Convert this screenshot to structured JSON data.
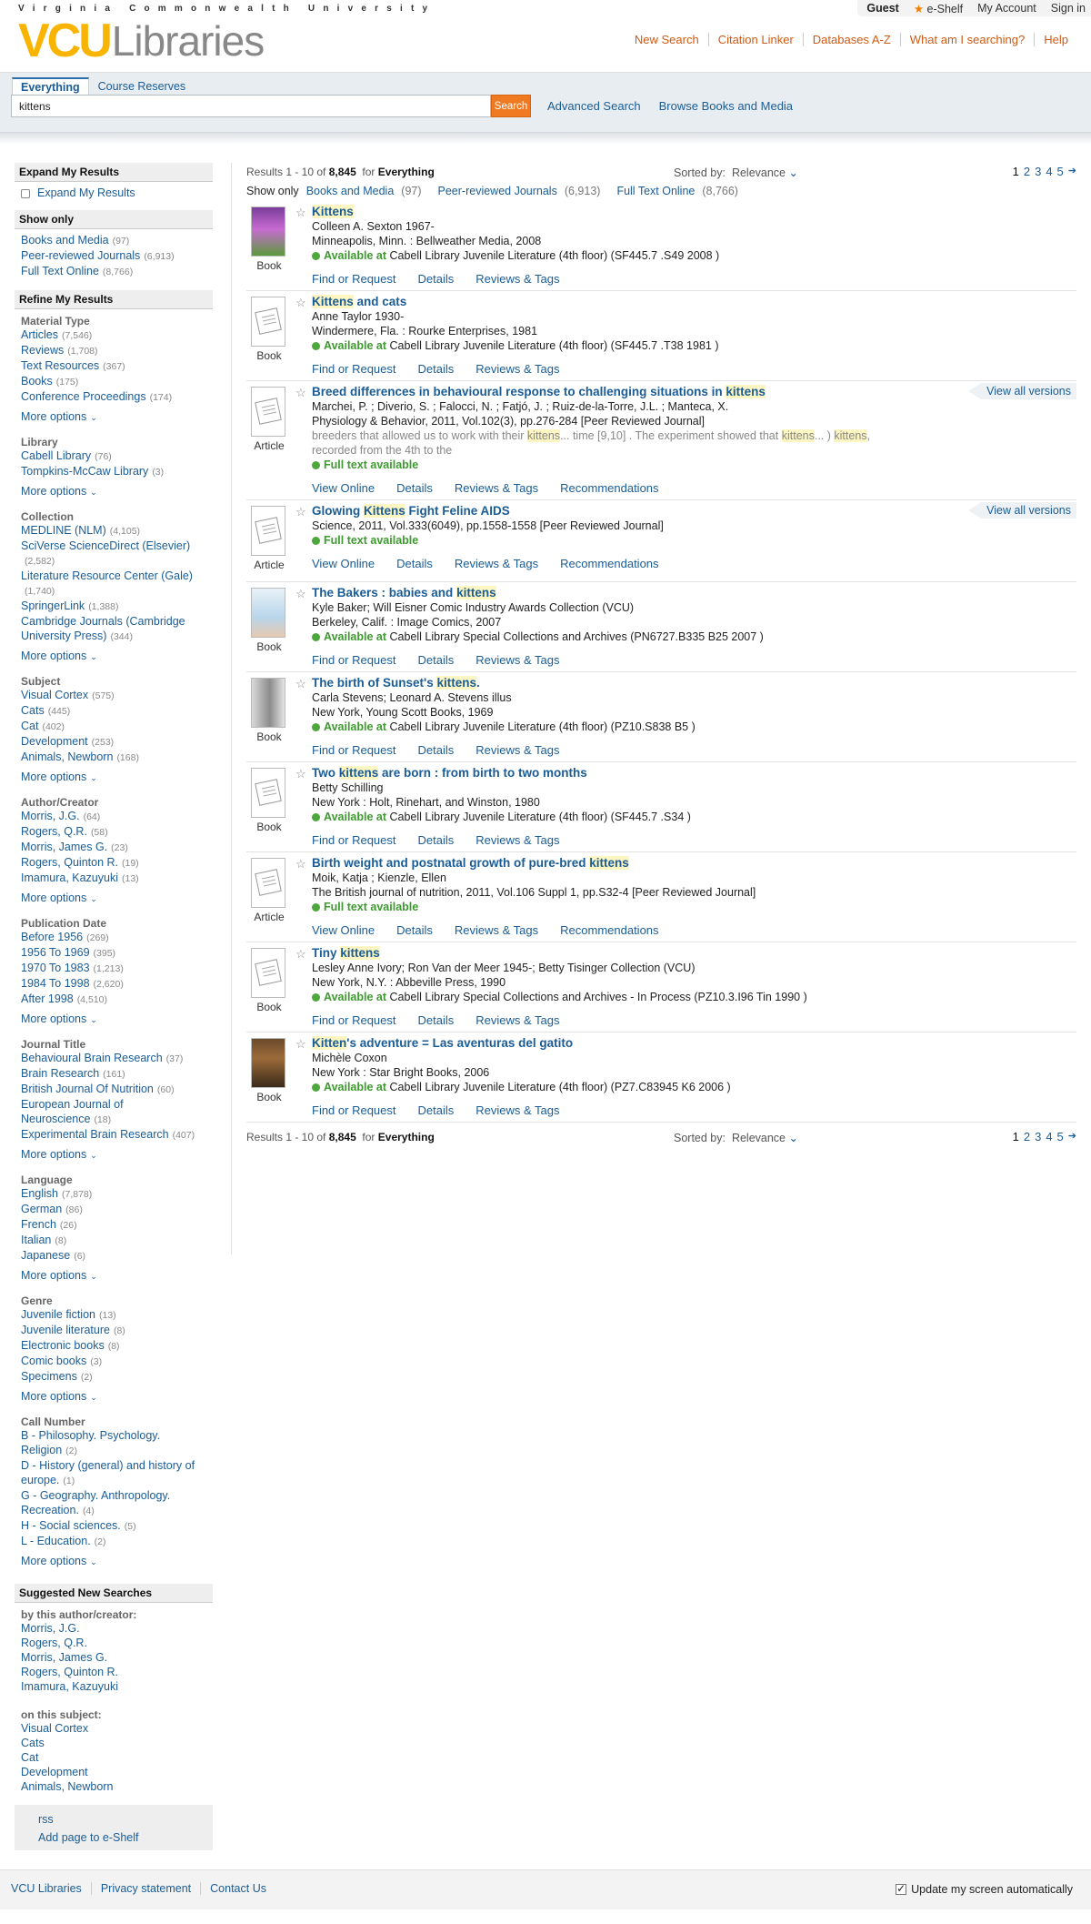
{
  "header": {
    "university": "Virginia Commonwealth University",
    "logo_vcu": "VCU",
    "logo_libraries": "Libraries",
    "user": {
      "guest": "Guest",
      "eshelf": "e-Shelf",
      "account": "My Account",
      "signin": "Sign in"
    },
    "links": [
      "New Search",
      "Citation Linker",
      "Databases A-Z",
      "What am I searching?",
      "Help"
    ]
  },
  "search": {
    "tabs": [
      "Everything",
      "Course Reserves"
    ],
    "query": "kittens",
    "button": "Search",
    "advanced": "Advanced Search",
    "browse": "Browse Books and Media"
  },
  "sidebar": {
    "expand": {
      "title": "Expand My Results",
      "checkbox": "Expand My Results"
    },
    "showonly": {
      "title": "Show only",
      "items": [
        {
          "label": "Books and Media",
          "count": "(97)"
        },
        {
          "label": "Peer-reviewed Journals",
          "count": "(6,913)"
        },
        {
          "label": "Full Text Online",
          "count": "(8,766)"
        }
      ]
    },
    "refine_title": "Refine My Results",
    "more": "More options",
    "facets": [
      {
        "title": "Material Type",
        "items": [
          {
            "label": "Articles",
            "count": "(7,546)"
          },
          {
            "label": "Reviews",
            "count": "(1,708)"
          },
          {
            "label": "Text Resources",
            "count": "(367)"
          },
          {
            "label": "Books",
            "count": "(175)"
          },
          {
            "label": "Conference Proceedings",
            "count": "(174)"
          }
        ]
      },
      {
        "title": "Library",
        "items": [
          {
            "label": "Cabell Library",
            "count": "(76)"
          },
          {
            "label": "Tompkins-McCaw Library",
            "count": "(3)"
          }
        ]
      },
      {
        "title": "Collection",
        "items": [
          {
            "label": "MEDLINE (NLM)",
            "count": "(4,105)"
          },
          {
            "label": "SciVerse ScienceDirect (Elsevier)",
            "count": "(2,582)"
          },
          {
            "label": "Literature Resource Center (Gale)",
            "count": "(1,740)"
          },
          {
            "label": "SpringerLink",
            "count": "(1,388)"
          },
          {
            "label": "Cambridge Journals (Cambridge University Press)",
            "count": "(344)"
          }
        ]
      },
      {
        "title": "Subject",
        "items": [
          {
            "label": "Visual Cortex",
            "count": "(575)"
          },
          {
            "label": "Cats",
            "count": "(445)"
          },
          {
            "label": "Cat",
            "count": "(402)"
          },
          {
            "label": "Development",
            "count": "(253)"
          },
          {
            "label": "Animals, Newborn",
            "count": "(168)"
          }
        ]
      },
      {
        "title": "Author/Creator",
        "items": [
          {
            "label": "Morris, J.G.",
            "count": "(64)"
          },
          {
            "label": "Rogers, Q.R.",
            "count": "(58)"
          },
          {
            "label": "Morris, James G.",
            "count": "(23)"
          },
          {
            "label": "Rogers, Quinton R.",
            "count": "(19)"
          },
          {
            "label": "Imamura, Kazuyuki",
            "count": "(13)"
          }
        ]
      },
      {
        "title": "Publication Date",
        "items": [
          {
            "label": "Before 1956",
            "count": "(269)"
          },
          {
            "label": "1956 To 1969",
            "count": "(395)"
          },
          {
            "label": "1970 To 1983",
            "count": "(1,213)"
          },
          {
            "label": "1984 To 1998",
            "count": "(2,620)"
          },
          {
            "label": "After 1998",
            "count": "(4,510)"
          }
        ]
      },
      {
        "title": "Journal Title",
        "items": [
          {
            "label": "Behavioural Brain Research",
            "count": "(37)"
          },
          {
            "label": "Brain Research",
            "count": "(161)"
          },
          {
            "label": "British Journal Of Nutrition",
            "count": "(60)"
          },
          {
            "label": "European Journal of Neuroscience",
            "count": "(18)"
          },
          {
            "label": "Experimental Brain Research",
            "count": "(407)"
          }
        ]
      },
      {
        "title": "Language",
        "items": [
          {
            "label": "English",
            "count": "(7,878)"
          },
          {
            "label": "German",
            "count": "(86)"
          },
          {
            "label": "French",
            "count": "(26)"
          },
          {
            "label": "Italian",
            "count": "(8)"
          },
          {
            "label": "Japanese",
            "count": "(6)"
          }
        ]
      },
      {
        "title": "Genre",
        "items": [
          {
            "label": "Juvenile fiction",
            "count": "(13)"
          },
          {
            "label": "Juvenile literature",
            "count": "(8)"
          },
          {
            "label": "Electronic books",
            "count": "(8)"
          },
          {
            "label": "Comic books",
            "count": "(3)"
          },
          {
            "label": "Specimens",
            "count": "(2)"
          }
        ]
      },
      {
        "title": "Call Number",
        "items": [
          {
            "label": "B - Philosophy. Psychology. Religion",
            "count": "(2)"
          },
          {
            "label": "D - History (general) and history of europe.",
            "count": "(1)"
          },
          {
            "label": "G - Geography. Anthropology. Recreation.",
            "count": "(4)"
          },
          {
            "label": "H - Social sciences.",
            "count": "(5)"
          },
          {
            "label": "L - Education.",
            "count": "(2)"
          }
        ]
      }
    ],
    "suggested": {
      "title": "Suggested New Searches",
      "by_author": "by this author/creator:",
      "authors": [
        "Morris, J.G.",
        "Rogers, Q.R.",
        "Morris, James G.",
        "Rogers, Quinton R.",
        "Imamura, Kazuyuki"
      ],
      "on_subject": "on this subject:",
      "subjects": [
        "Visual Cortex",
        "Cats",
        "Cat",
        "Development",
        "Animals, Newborn"
      ]
    },
    "rss": "rss",
    "add_eshelf": "Add page to e-Shelf"
  },
  "results": {
    "range": "Results 1 - 10 of",
    "total": "8,845",
    "for_label": "for",
    "scope": "Everything",
    "sorted_label": "Sorted by:",
    "sorted_value": "Relevance",
    "pages": [
      "1",
      "2",
      "3",
      "4",
      "5"
    ],
    "showonly_label": "Show only",
    "showonly": [
      {
        "label": "Books and Media",
        "count": "(97)"
      },
      {
        "label": "Peer-reviewed Journals",
        "count": "(6,913)"
      },
      {
        "label": "Full Text Online",
        "count": "(8,766)"
      }
    ],
    "view_all_versions": "View all versions",
    "items": [
      {
        "type": "Book",
        "title": "Kittens",
        "lines": [
          "Colleen A. Sexton 1967-",
          "Minneapolis, Minn. : Bellweather Media, 2008"
        ],
        "status": "Available at",
        "location": "Cabell Library Juvenile Literature (4th floor) (SF445.7 .S49 2008 )",
        "actions": [
          "Find or Request",
          "Details",
          "Reviews & Tags"
        ],
        "thumb": "cover-purple"
      },
      {
        "type": "Book",
        "title": "Kittens and cats",
        "lines": [
          "Anne Taylor 1930-",
          "Windermere, Fla. : Rourke Enterprises, 1981"
        ],
        "status": "Available at",
        "location": "Cabell Library Juvenile Literature (4th floor) (SF445.7 .T38 1981 )",
        "actions": [
          "Find or Request",
          "Details",
          "Reviews & Tags"
        ],
        "thumb": "generic"
      },
      {
        "type": "Article",
        "title": "Breed differences in behavioural response to challenging situations in kittens",
        "lines": [
          "Marchei, P. ; Diverio, S. ; Falocci, N. ; Fatjó, J. ; Ruiz-de-la-Torre, J.L. ; Manteca, X.",
          "Physiology & Behavior, 2011, Vol.102(3), pp.276-284 [Peer Reviewed Journal]"
        ],
        "snippet": "breeders that allowed us to work with their kittens... time [9,10] . The experiment showed that kittens... ) kittens, recorded from the 4th to the",
        "status": "Full text available",
        "location": "",
        "versions": true,
        "actions": [
          "View Online",
          "Details",
          "Reviews & Tags",
          "Recommendations"
        ],
        "thumb": "generic"
      },
      {
        "type": "Article",
        "title": "Glowing Kittens Fight Feline AIDS",
        "lines": [
          "Science, 2011, Vol.333(6049), pp.1558-1558 [Peer Reviewed Journal]"
        ],
        "status": "Full text available",
        "location": "",
        "versions": true,
        "actions": [
          "View Online",
          "Details",
          "Reviews & Tags",
          "Recommendations"
        ],
        "thumb": "generic"
      },
      {
        "type": "Book",
        "title": "The Bakers : babies and kittens",
        "lines": [
          "Kyle Baker; Will Eisner Comic Industry Awards Collection (VCU)",
          "Berkeley, Calif. : Image Comics, 2007"
        ],
        "status": "Available at",
        "location": "Cabell Library Special Collections and Archives (PN6727.B335 B25 2007 )",
        "actions": [
          "Find or Request",
          "Details",
          "Reviews & Tags"
        ],
        "thumb": "cover-comic"
      },
      {
        "type": "Book",
        "title": "The birth of Sunset's kittens.",
        "lines": [
          "Carla Stevens; Leonard A. Stevens illus",
          "New York, Young Scott Books, 1969"
        ],
        "status": "Available at",
        "location": "Cabell Library Juvenile Literature (4th floor) (PZ10.S838 B5 )",
        "actions": [
          "Find or Request",
          "Details",
          "Reviews & Tags"
        ],
        "thumb": "cover-grey"
      },
      {
        "type": "Book",
        "title": "Two kittens are born : from birth to two months",
        "lines": [
          "Betty Schilling",
          "New York : Holt, Rinehart, and Winston, 1980"
        ],
        "status": "Available at",
        "location": "Cabell Library Juvenile Literature (4th floor) (SF445.7 .S34 )",
        "actions": [
          "Find or Request",
          "Details",
          "Reviews & Tags"
        ],
        "thumb": "generic"
      },
      {
        "type": "Article",
        "title": "Birth weight and postnatal growth of pure-bred kittens",
        "lines": [
          "Moik, Katja ; Kienzle, Ellen",
          "The British journal of nutrition, 2011, Vol.106 Suppl 1, pp.S32-4 [Peer Reviewed Journal]"
        ],
        "status": "Full text available",
        "location": "",
        "actions": [
          "View Online",
          "Details",
          "Reviews & Tags",
          "Recommendations"
        ],
        "thumb": "generic"
      },
      {
        "type": "Book",
        "title": "Tiny kittens",
        "lines": [
          "Lesley Anne Ivory; Ron Van der Meer 1945-; Betty Tisinger Collection (VCU)",
          "New York, N.Y. : Abbeville Press, 1990"
        ],
        "status": "Available at",
        "location": "Cabell Library Special Collections and Archives - In Process (PZ10.3.I96 Tin 1990 )",
        "actions": [
          "Find or Request",
          "Details",
          "Reviews & Tags"
        ],
        "thumb": "generic"
      },
      {
        "type": "Book",
        "title": "Kitten's adventure = Las aventuras del gatito",
        "lines": [
          "Michèle Coxon",
          "New York : Star Bright Books, 2006"
        ],
        "status": "Available at",
        "location": "Cabell Library Juvenile Literature (4th floor) (PZ7.C83945 K6 2006 )",
        "actions": [
          "Find or Request",
          "Details",
          "Reviews & Tags"
        ],
        "thumb": "cover-brown"
      }
    ]
  },
  "footer": {
    "links": [
      "VCU Libraries",
      "Privacy statement",
      "Contact Us"
    ],
    "update": "Update my screen automatically"
  },
  "colors": {
    "accent": "#ef7a22",
    "link": "#1a5c96",
    "available": "#4ca83b",
    "logo_gold": "#f8b400"
  }
}
